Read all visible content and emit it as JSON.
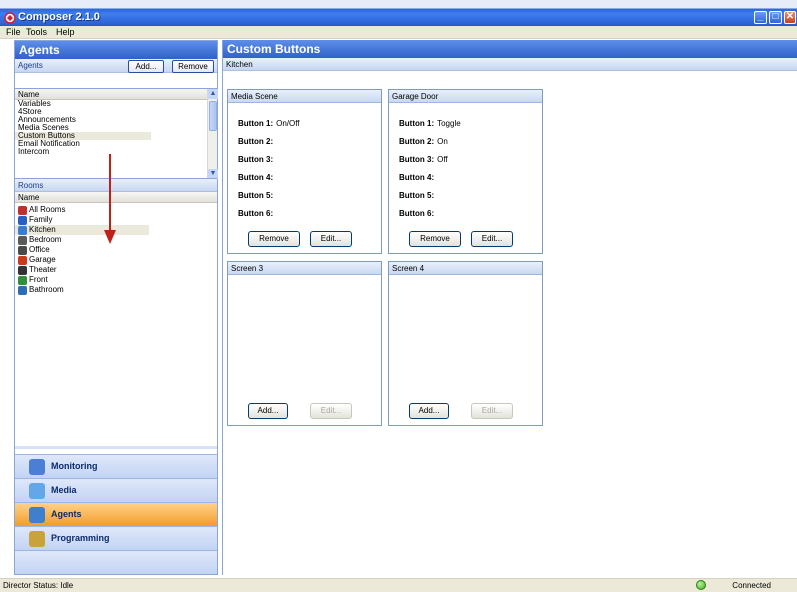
{
  "window": {
    "title": "Composer 2.1.0"
  },
  "menu": [
    "File",
    "Tools",
    "Help"
  ],
  "left": {
    "title": "Agents",
    "agents_label": "Agents",
    "add_label": "Add...",
    "remove_label": "Remove",
    "col_name": "Name",
    "agents": [
      "Variables",
      "4Store",
      "Announcements",
      "Media Scenes",
      "Custom Buttons",
      "Email Notification",
      "Intercom"
    ],
    "selected_agent": "Custom Buttons",
    "rooms_label": "Rooms",
    "rooms": [
      "All Rooms",
      "Family",
      "Kitchen",
      "Bedroom",
      "Office",
      "Garage",
      "Theater",
      "Front",
      "Bathroom"
    ],
    "selected_room": "Kitchen",
    "nav": [
      "Monitoring",
      "Media",
      "Agents",
      "Programming"
    ],
    "active_nav": "Agents"
  },
  "right": {
    "title": "Custom Buttons",
    "breadcrumb": "Kitchen",
    "panels": [
      {
        "name": "Media Scene",
        "buttons": [
          {
            "label": "Button 1:",
            "value": "On/Off"
          },
          {
            "label": "Button 2:",
            "value": ""
          },
          {
            "label": "Button 3:",
            "value": ""
          },
          {
            "label": "Button 4:",
            "value": ""
          },
          {
            "label": "Button 5:",
            "value": ""
          },
          {
            "label": "Button 6:",
            "value": ""
          }
        ],
        "btn1": "Remove",
        "btn2": "Edit..."
      },
      {
        "name": "Garage Door",
        "buttons": [
          {
            "label": "Button 1:",
            "value": "Toggle"
          },
          {
            "label": "Button 2:",
            "value": "On"
          },
          {
            "label": "Button 3:",
            "value": "Off"
          },
          {
            "label": "Button 4:",
            "value": ""
          },
          {
            "label": "Button 5:",
            "value": ""
          },
          {
            "label": "Button 6:",
            "value": ""
          }
        ],
        "btn1": "Remove",
        "btn2": "Edit..."
      },
      {
        "name": "Screen 3",
        "btn1": "Add...",
        "btn2": "Edit..."
      },
      {
        "name": "Screen 4",
        "btn1": "Add...",
        "btn2": "Edit..."
      }
    ]
  },
  "status": {
    "left": "Director Status: Idle",
    "right": "Connected"
  },
  "colors": {
    "header_blue": "#2f62c8",
    "active_nav": "#f49c2a",
    "arrow": "#c0201a"
  }
}
